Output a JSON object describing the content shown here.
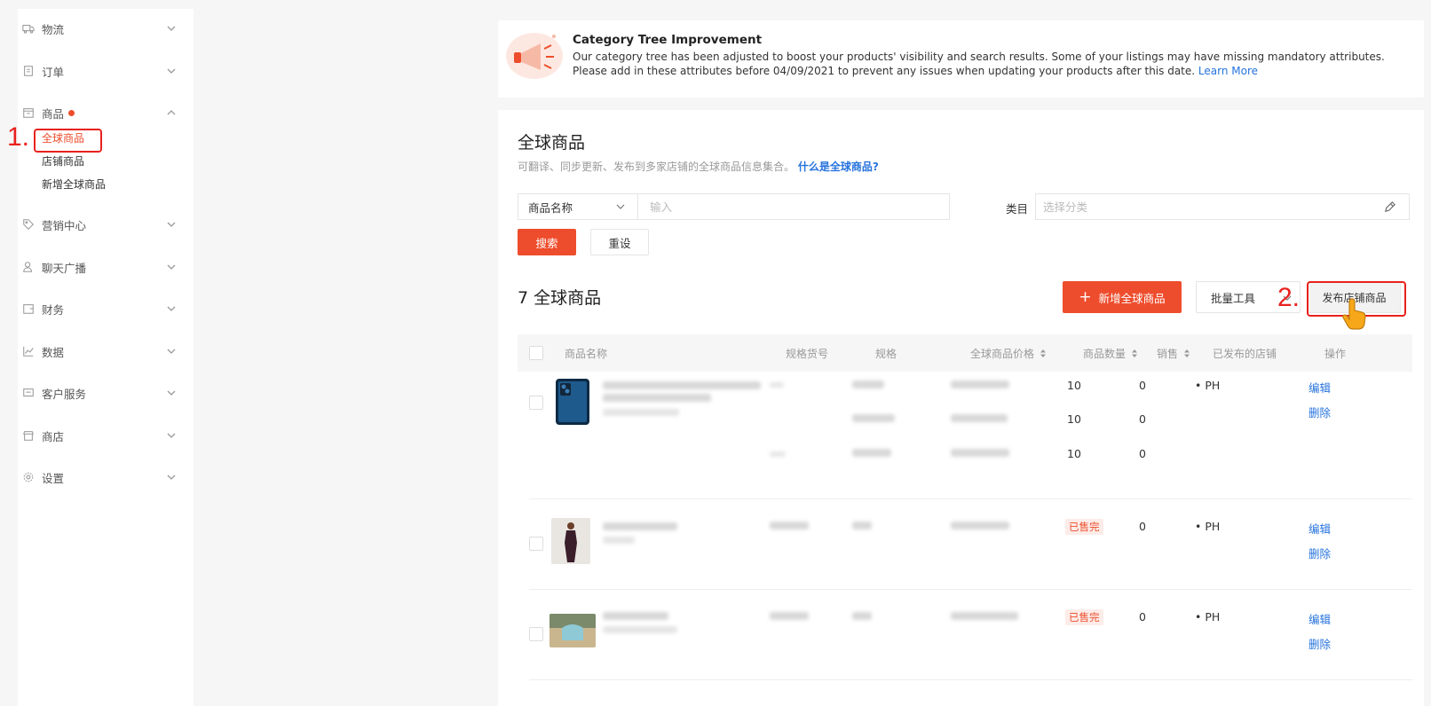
{
  "sidebar": {
    "items": [
      {
        "label": "物流",
        "icon": "truck-icon"
      },
      {
        "label": "订单",
        "icon": "clipboard-icon"
      },
      {
        "label": "商品",
        "icon": "box-icon"
      },
      {
        "label": "营销中心",
        "icon": "tag-icon"
      },
      {
        "label": "聊天广播",
        "icon": "chat-user-icon"
      },
      {
        "label": "财务",
        "icon": "wallet-icon"
      },
      {
        "label": "数据",
        "icon": "chart-icon"
      },
      {
        "label": "客户服务",
        "icon": "support-icon"
      },
      {
        "label": "商店",
        "icon": "shop-icon"
      },
      {
        "label": "设置",
        "icon": "gear-icon"
      }
    ],
    "sub_items": [
      "全球商品",
      "店铺商品",
      "新增全球商品"
    ]
  },
  "annotations": {
    "step1": "1.",
    "step2": "2."
  },
  "banner": {
    "title": "Category Tree Improvement",
    "text": "Our category tree has been adjusted to boost your products' visibility and search results. Some of your listings may have missing mandatory attributes. Please add in these attributes before 04/09/2021 to prevent any issues when updating your products after this date.",
    "link": "Learn More"
  },
  "page": {
    "title": "全球商品",
    "desc": "可翻译、同步更新、发布到多家店铺的全球商品信息集合。",
    "desc_link": "什么是全球商品?"
  },
  "filter": {
    "select_value": "商品名称",
    "input_placeholder": "输入",
    "category_label": "类目",
    "category_placeholder": "选择分类",
    "search_label": "搜索",
    "reset_label": "重设"
  },
  "toolbar": {
    "count_title": "7 全球商品",
    "add_label": "新增全球商品",
    "batch_label": "批量工具",
    "publish_label": "发布店铺商品"
  },
  "table": {
    "columns": [
      "商品名称",
      "规格货号",
      "规格",
      "全球商品价格",
      "商品数量",
      "销售",
      "已发布的店铺",
      "操作"
    ],
    "rows": [
      {
        "variants": [
          {
            "qty": "10",
            "sales": "0"
          },
          {
            "qty": "10",
            "sales": "0"
          },
          {
            "qty": "10",
            "sales": "0"
          }
        ],
        "store": "• PH",
        "edit": "编辑",
        "delete": "删除"
      },
      {
        "qty": "已售完",
        "sales": "0",
        "store": "• PH",
        "edit": "编辑",
        "delete": "删除"
      },
      {
        "qty": "已售完",
        "sales": "0",
        "store": "• PH",
        "edit": "编辑",
        "delete": "删除"
      }
    ]
  },
  "colors": {
    "brand": "#ee4d2d",
    "link": "#2673dd",
    "annotation": "#e8211d"
  }
}
